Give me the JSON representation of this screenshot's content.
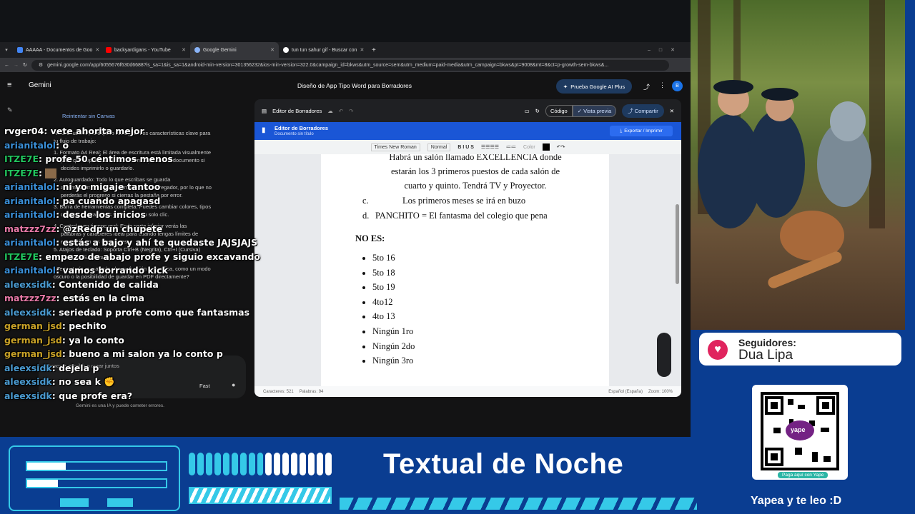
{
  "browser": {
    "tabs": [
      {
        "label": "AAAAA - Documentos de Goo",
        "color": "#4285f4"
      },
      {
        "label": "backyardigans - YouTube",
        "color": "#ff0000"
      },
      {
        "label": "Google Gemini",
        "color": "#8ab4f8"
      },
      {
        "label": "tun tun sahur gif - Buscar con",
        "color": "#ffffff"
      }
    ],
    "url": "gemini.google.com/app/6055676f630d6688?is_sa=1&is_sa=1&android-min-version=301356232&ios-min-version=322.0&campaign_id=bkws&utm_source=sem&utm_medium=paid-media&utm_campaign=bkws&pt=9008&mt=8&ct=p-growth-sem-bkws&..."
  },
  "gemini": {
    "brand": "Gemini",
    "title": "Diseño de App Tipo Word para Borradores",
    "plus_button": "Prueba Google AI Plus",
    "avatar": "B",
    "retry_link": "Reintentar sin Canvas",
    "chat_lines": [
      "A continuación, te explico las siguientes características clave para",
      "tu flujo de trabajo:",
      "1. Formato A4 Real: El área de escritura está limitada visualmente",
      "para que sepas exactamente cómo quedará el documento si",
      "decides imprimirlo o guardarlo.",
      "2. Autoguardado: Todo lo que escribas se guarda",
      "automáticamente en la memoria de tu navegador, por lo que no",
      "perderás el progreso si cierras la pestaña por error.",
      "3. Barra de herramientas completa: Puedes cambiar colores, tipos",
      "de letra, alineaciones y listas con un solo clic.",
      "4. Contador en tiempo real: En la parte inferior verás las",
      "palabras y caracteres ideal para cuando tengas límites de",
      "extensión en tus borradores.",
      "5. Atajos de teclado: Soporta Ctrl+B (Negrita), Ctrl+I (Cursiva)",
      "y Ctrl+U (Subrayado).",
      "¿Te gustaría que añada alguna función específica, como un modo",
      "oscuro o la posibilidad de guardar en PDF directamente?"
    ],
    "input_placeholder": "Vamos a escribir o crear juntos",
    "mode": "Fast",
    "disclaimer": "Gemini es una IA y puede cometer errores."
  },
  "editor": {
    "header_label": "Editor de Borradores",
    "code_tab": "Código",
    "preview_tab": "Vista previa",
    "share_button": "Compartir",
    "app_title": "Editor de Borradores",
    "app_subtitle": "Documento sin título",
    "export_button": "Exportar / Imprimir",
    "font_select": "Times New Roman",
    "style_select": "Normal",
    "color_label": "Color",
    "doc": {
      "item_b_lines": [
        "Habrá un salón llamado EXCELLENCIA donde",
        "estarán los 3 primeros puestos de cada salón de",
        "cuarto y quinto. Tendrá TV y Proyector."
      ],
      "item_c_marker": "c.",
      "item_c": "Los primeros meses se irá en buzo",
      "item_d_marker": "d.",
      "item_d": "PANCHITO = El fantasma del colegio que pena",
      "heading": "NO ES:",
      "bullets": [
        "5to 16",
        "5to 18",
        "5to 19",
        "4to12",
        "4to 13",
        "Ningún 1ro",
        "Ningún 2do",
        "Ningún 3ro"
      ]
    },
    "footer": {
      "chars": "Caracteres: 521",
      "words": "Palabras: 94",
      "lang": "Español (España)",
      "zoom": "Zoom: 100%"
    }
  },
  "stream_chat": [
    {
      "user": "rvger04",
      "color": "#ffffff",
      "text": "vete ahorita mejor"
    },
    {
      "user": "arianitalol",
      "color": "#3a8fd8",
      "text": "o"
    },
    {
      "user": "ITZE7E",
      "color": "#22c55e",
      "text": "profe 50 céntimos menos"
    },
    {
      "user": "ITZE7E",
      "color": "#22c55e",
      "text": ""
    },
    {
      "user": "arianitalol",
      "color": "#3a8fd8",
      "text": "ni yo migaje tantoo"
    },
    {
      "user": "arianitalol",
      "color": "#3a8fd8",
      "text": "pa cuando apagasd"
    },
    {
      "user": "arianitalol",
      "color": "#3a8fd8",
      "text": "desde los inicios"
    },
    {
      "user": "matzzz7zz",
      "color": "#e87aa8",
      "text": "@zRedp un chupete"
    },
    {
      "user": "arianitalol",
      "color": "#3a8fd8",
      "text": "estás a bajo y ahí te quedaste JAJSJAJS"
    },
    {
      "user": "ITZE7E",
      "color": "#22c55e",
      "text": "empezo de abajo profe y siguio excavando"
    },
    {
      "user": "arianitalol",
      "color": "#3a8fd8",
      "text": "vamos borrando kick"
    },
    {
      "user": "aleexsidk",
      "color": "#4a9ad0",
      "text": "Contenido de calida"
    },
    {
      "user": "matzzz7zz",
      "color": "#e87aa8",
      "text": "estás en la cima"
    },
    {
      "user": "aleexsidk",
      "color": "#4a9ad0",
      "text": "seriedad p profe como que fantasmas"
    },
    {
      "user": "german_jsd",
      "color": "#c9a227",
      "text": "pechito"
    },
    {
      "user": "german_jsd",
      "color": "#c9a227",
      "text": "ya lo conto"
    },
    {
      "user": "german_jsd",
      "color": "#c9a227",
      "text": "bueno a mi salon ya lo conto p"
    },
    {
      "user": "aleexsidk",
      "color": "#4a9ad0",
      "text": "dejela p"
    },
    {
      "user": "aleexsidk",
      "color": "#4a9ad0",
      "text": "no sea k"
    },
    {
      "user": "aleexsidk",
      "color": "#4a9ad0",
      "text": "que profe era?"
    }
  ],
  "overlay": {
    "followers_label": "Seguidores:",
    "followers_name": "Dua Lipa",
    "title": "Textual de Noche",
    "qr_brand": "yape",
    "qr_caption": "Paga aquí con Yape",
    "yape_text": "Yapea y te leo :D"
  }
}
